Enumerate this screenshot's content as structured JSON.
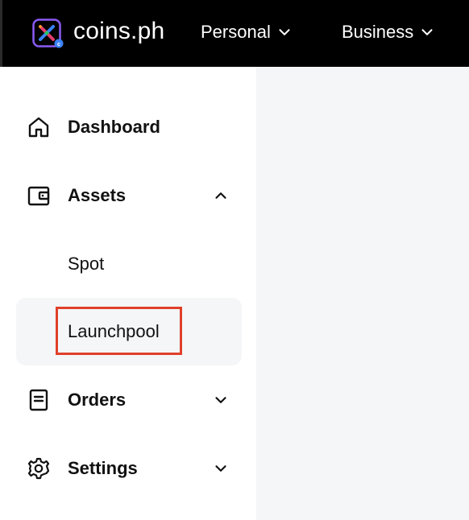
{
  "header": {
    "brand": "coins.ph",
    "menus": [
      {
        "label": "Personal"
      },
      {
        "label": "Business"
      }
    ]
  },
  "sidebar": {
    "items": [
      {
        "label": "Dashboard",
        "icon": "home-icon"
      },
      {
        "label": "Assets",
        "icon": "wallet-icon",
        "expanded": true,
        "children": [
          {
            "label": "Spot",
            "active": false
          },
          {
            "label": "Launchpool",
            "active": true
          }
        ]
      },
      {
        "label": "Orders",
        "icon": "document-icon",
        "expanded": false
      },
      {
        "label": "Settings",
        "icon": "gear-icon",
        "expanded": false
      }
    ]
  },
  "colors": {
    "header_bg": "#000000",
    "active_bg": "#f5f6f8",
    "highlight": "#e0402a",
    "logo_accent_1": "#3b82f6",
    "logo_accent_2": "#e53b6b",
    "logo_accent_3": "#22c55e",
    "logo_accent_4": "#f5a623"
  }
}
